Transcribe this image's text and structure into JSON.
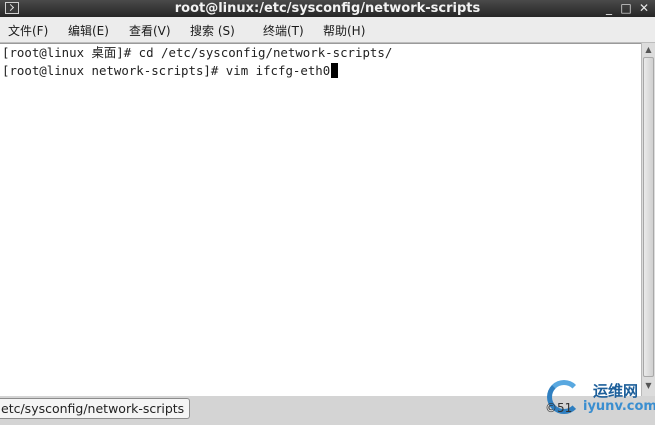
{
  "window": {
    "title": "root@linux:/etc/sysconfig/network-scripts",
    "minimize": "_",
    "maximize": "□",
    "close": "✕"
  },
  "menu": [
    {
      "label": "文件(F)"
    },
    {
      "label": "编辑(E)"
    },
    {
      "label": "查看(V)"
    },
    {
      "label": "搜索 (S)"
    },
    {
      "label": "终端(T)"
    },
    {
      "label": "帮助(H)"
    }
  ],
  "terminal": {
    "lines": [
      "[root@linux 桌面]# cd /etc/sysconfig/network-scripts/",
      "[root@linux network-scripts]# vim ifcfg-eth0"
    ]
  },
  "scrollbar": {
    "up": "▲",
    "down": "▼"
  },
  "tooltip": {
    "text": "etc/sysconfig/network-scripts"
  },
  "watermark": {
    "title": "运维网",
    "url": "iyunv.com",
    "prefix": "©51"
  },
  "colors": {
    "titlebar": "#2f2f2f",
    "terminal_bg": "#ffffff",
    "terminal_fg": "#222222",
    "watermark_blue": "#2f7fc0"
  }
}
